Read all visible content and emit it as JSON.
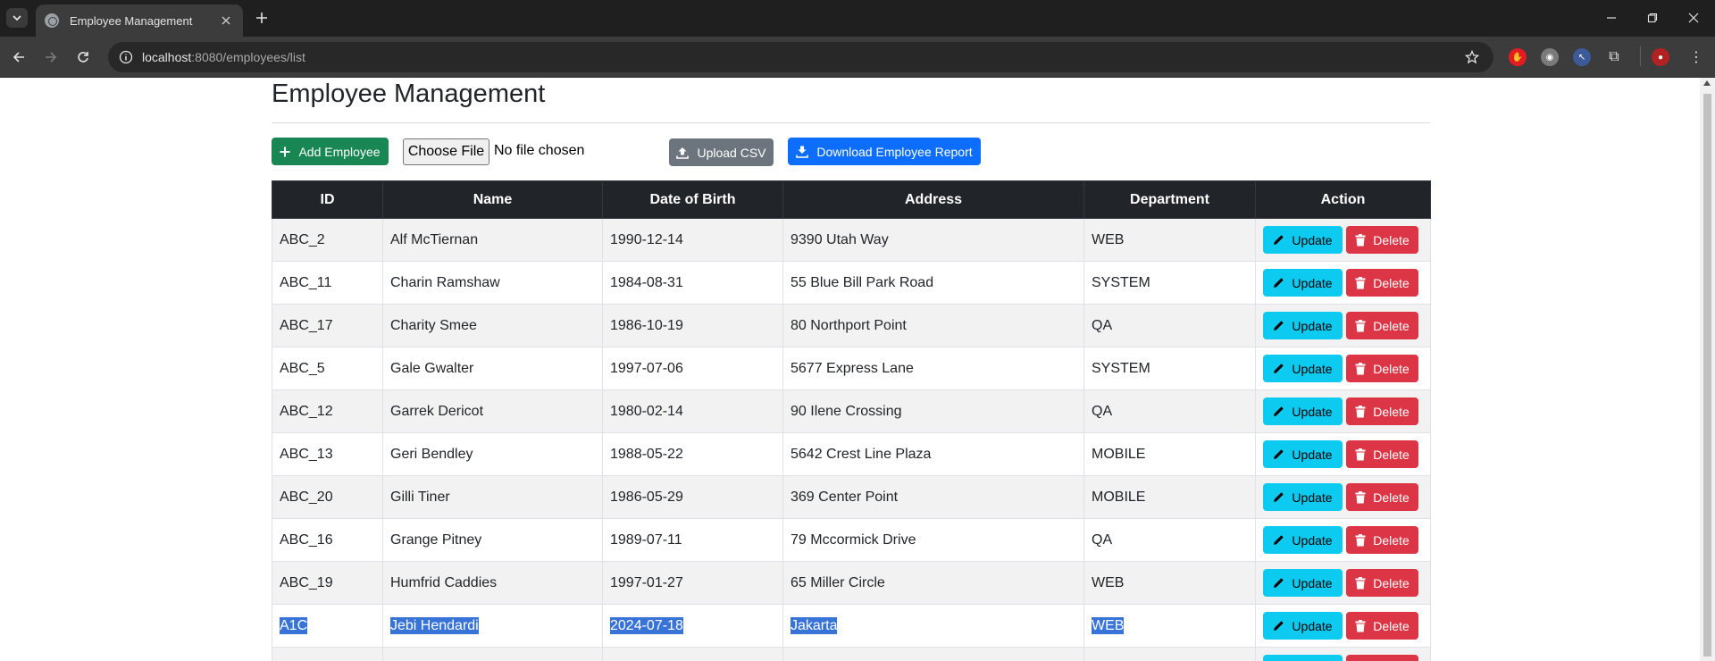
{
  "browser": {
    "tab_title": "Employee Management",
    "url_host": "localhost",
    "url_rest": ":8080/employees/list"
  },
  "page": {
    "title": "Employee Management",
    "add_button": "Add Employee",
    "choose_file": "Choose File",
    "file_status": "No file chosen",
    "upload_button": "Upload CSV",
    "download_button": "Download Employee Report"
  },
  "table": {
    "headers": [
      "ID",
      "Name",
      "Date of Birth",
      "Address",
      "Department",
      "Action"
    ],
    "update_label": "Update",
    "delete_label": "Delete",
    "rows": [
      {
        "id": "ABC_2",
        "name": "Alf McTiernan",
        "dob": "1990-12-14",
        "address": "9390 Utah Way",
        "department": "WEB"
      },
      {
        "id": "ABC_11",
        "name": "Charin Ramshaw",
        "dob": "1984-08-31",
        "address": "55 Blue Bill Park Road",
        "department": "SYSTEM"
      },
      {
        "id": "ABC_17",
        "name": "Charity Smee",
        "dob": "1986-10-19",
        "address": "80 Northport Point",
        "department": "QA"
      },
      {
        "id": "ABC_5",
        "name": "Gale Gwalter",
        "dob": "1997-07-06",
        "address": "5677 Express Lane",
        "department": "SYSTEM"
      },
      {
        "id": "ABC_12",
        "name": "Garrek Dericot",
        "dob": "1980-02-14",
        "address": "90 Ilene Crossing",
        "department": "QA"
      },
      {
        "id": "ABC_13",
        "name": "Geri Bendley",
        "dob": "1988-05-22",
        "address": "5642 Crest Line Plaza",
        "department": "MOBILE"
      },
      {
        "id": "ABC_20",
        "name": "Gilli Tiner",
        "dob": "1986-05-29",
        "address": "369 Center Point",
        "department": "MOBILE"
      },
      {
        "id": "ABC_16",
        "name": "Grange Pitney",
        "dob": "1989-07-11",
        "address": "79 Mccormick Drive",
        "department": "QA"
      },
      {
        "id": "ABC_19",
        "name": "Humfrid Caddies",
        "dob": "1997-01-27",
        "address": "65 Miller Circle",
        "department": "WEB"
      },
      {
        "id": "A1C",
        "name": "Jebi Hendardi",
        "dob": "2024-07-18",
        "address": "Jakarta",
        "department": "WEB",
        "selected": true
      }
    ]
  },
  "colors": {
    "add": "#198754",
    "upload": "#6c757d",
    "download": "#0d6efd",
    "update": "#0dcaf0",
    "delete": "#dc3545",
    "header": "#212529",
    "selection": "#3874d8"
  }
}
